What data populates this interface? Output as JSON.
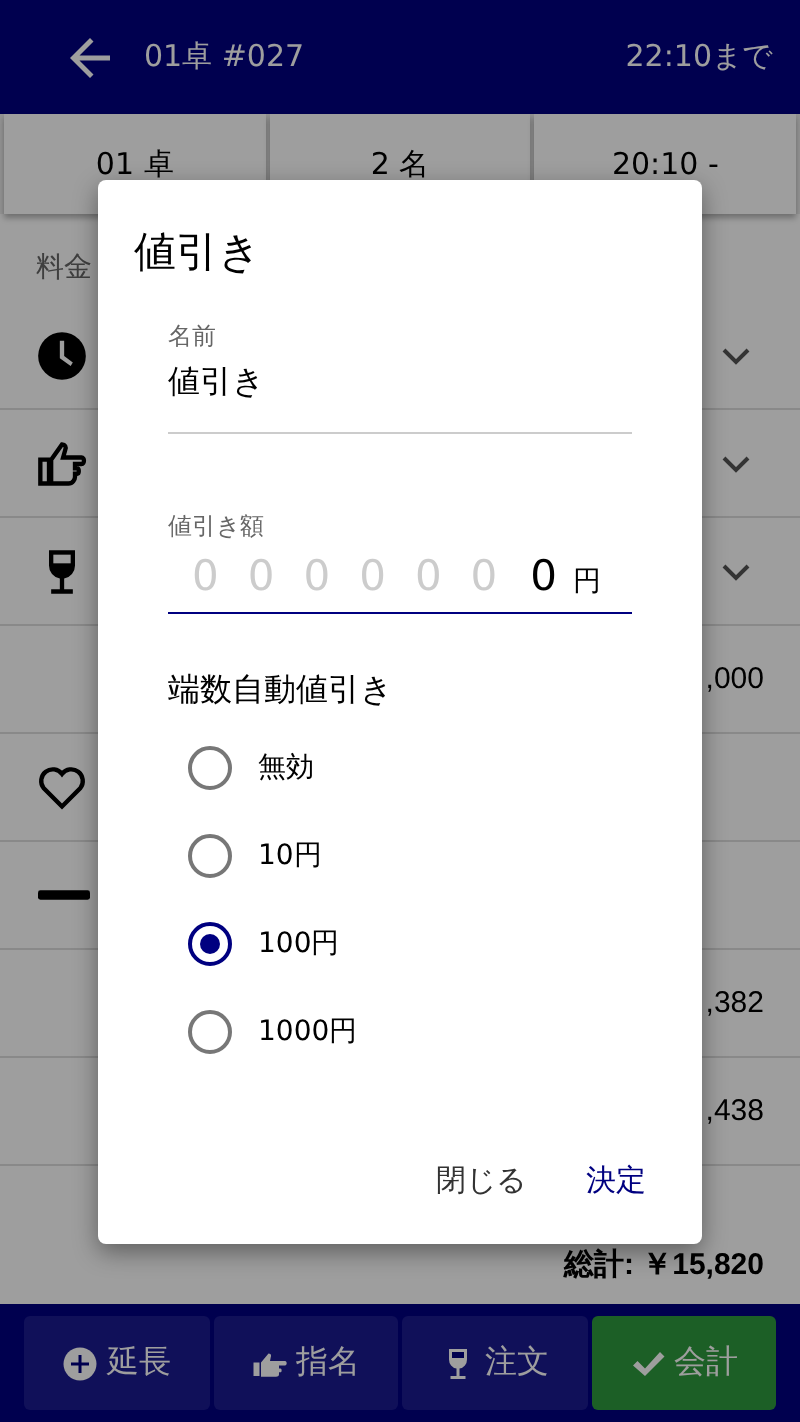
{
  "header": {
    "title": "01卓 #027",
    "until": "22:10まで"
  },
  "info": [
    "01 卓",
    "2 名",
    "20:10 -"
  ],
  "section_label": "料金",
  "rows": [
    {
      "kind": "clock",
      "expandable": true
    },
    {
      "kind": "hand",
      "expandable": true
    },
    {
      "kind": "glass",
      "expandable": true
    },
    {
      "kind": "amount",
      "amount": ",000"
    },
    {
      "kind": "heart"
    },
    {
      "kind": "minus"
    },
    {
      "kind": "amount",
      "amount": ",382"
    },
    {
      "kind": "amount",
      "amount": ",438"
    }
  ],
  "total": "総計: ￥15,820",
  "bottom_bar": [
    {
      "label": "延長",
      "kind": "plus",
      "primary": false
    },
    {
      "label": "指名",
      "kind": "hand",
      "primary": false
    },
    {
      "label": "注文",
      "kind": "glass",
      "primary": false
    },
    {
      "label": "会計",
      "kind": "check",
      "primary": true
    }
  ],
  "dialog": {
    "title": "値引き",
    "name_field": {
      "label": "名前",
      "value": "値引き"
    },
    "amount_field": {
      "label": "値引き額",
      "placeholder": "000000",
      "value": "0",
      "unit": "円"
    },
    "rounding": {
      "label": "端数自動値引き",
      "options": [
        {
          "label": "無効",
          "selected": false
        },
        {
          "label": "10円",
          "selected": false
        },
        {
          "label": "100円",
          "selected": true
        },
        {
          "label": "1000円",
          "selected": false
        }
      ]
    },
    "buttons": [
      {
        "label": "閉じる",
        "primary": false
      },
      {
        "label": "決定",
        "primary": true
      }
    ]
  }
}
